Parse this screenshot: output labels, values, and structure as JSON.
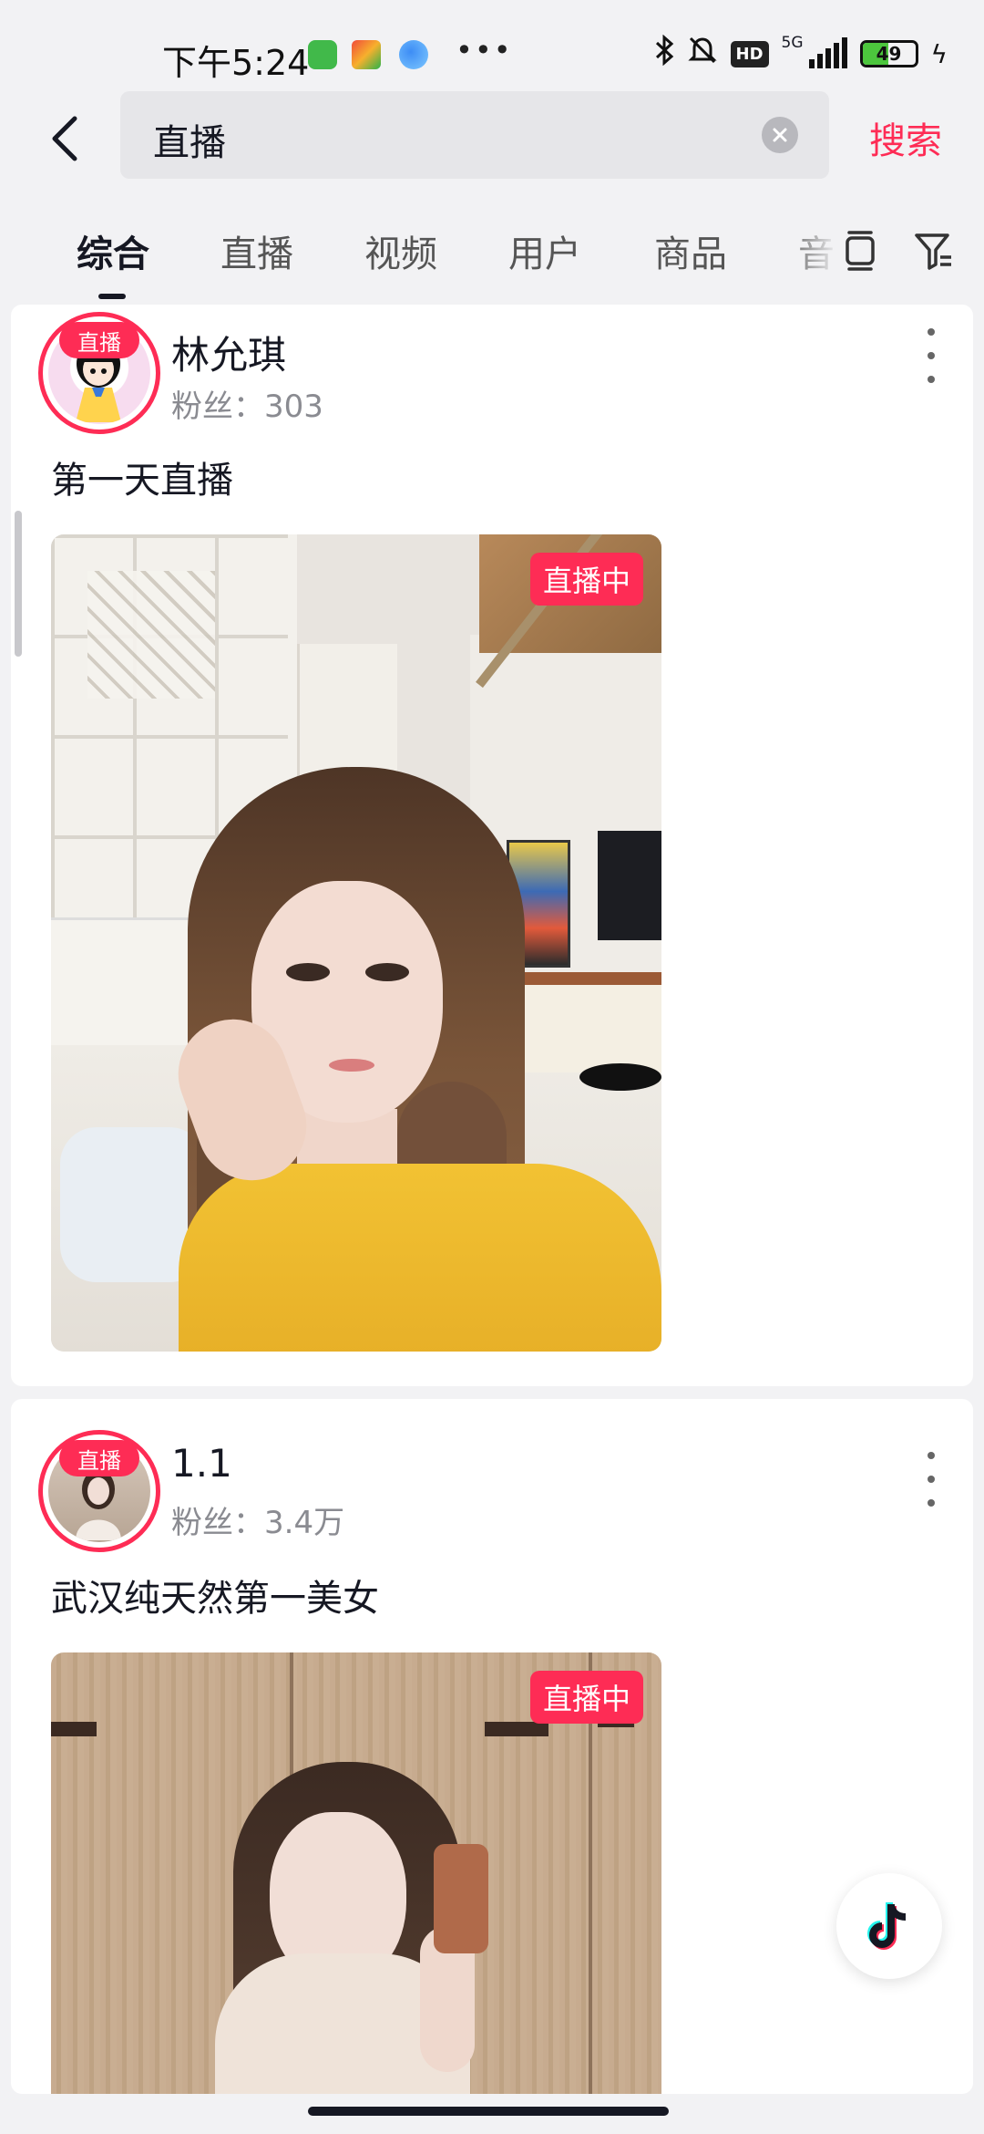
{
  "status_bar": {
    "time": "下午5:24",
    "network": "5G",
    "hd": "HD",
    "battery": "49",
    "battery_level": 0.49
  },
  "search": {
    "query": "直播",
    "submit_label": "搜索"
  },
  "tabs": [
    "综合",
    "直播",
    "视频",
    "用户",
    "商品",
    "音"
  ],
  "results": [
    {
      "avatar_tag": "直播",
      "name": "林允琪",
      "fans": "粉丝：303",
      "description": "第一天直播",
      "live_badge": "直播中"
    },
    {
      "avatar_tag": "直播",
      "name": "1.1",
      "fans": "粉丝：3.4万",
      "description": "武汉纯天然第一美女",
      "live_badge": "直播中"
    }
  ],
  "icons": {
    "back": "back-arrow-icon",
    "clear": "clear-icon",
    "layout": "layout-icon",
    "filter": "filter-icon",
    "more": "more-icon",
    "float": "douyin-logo-icon"
  },
  "colors": {
    "accent": "#fe2c55",
    "background": "#f2f2f4"
  }
}
